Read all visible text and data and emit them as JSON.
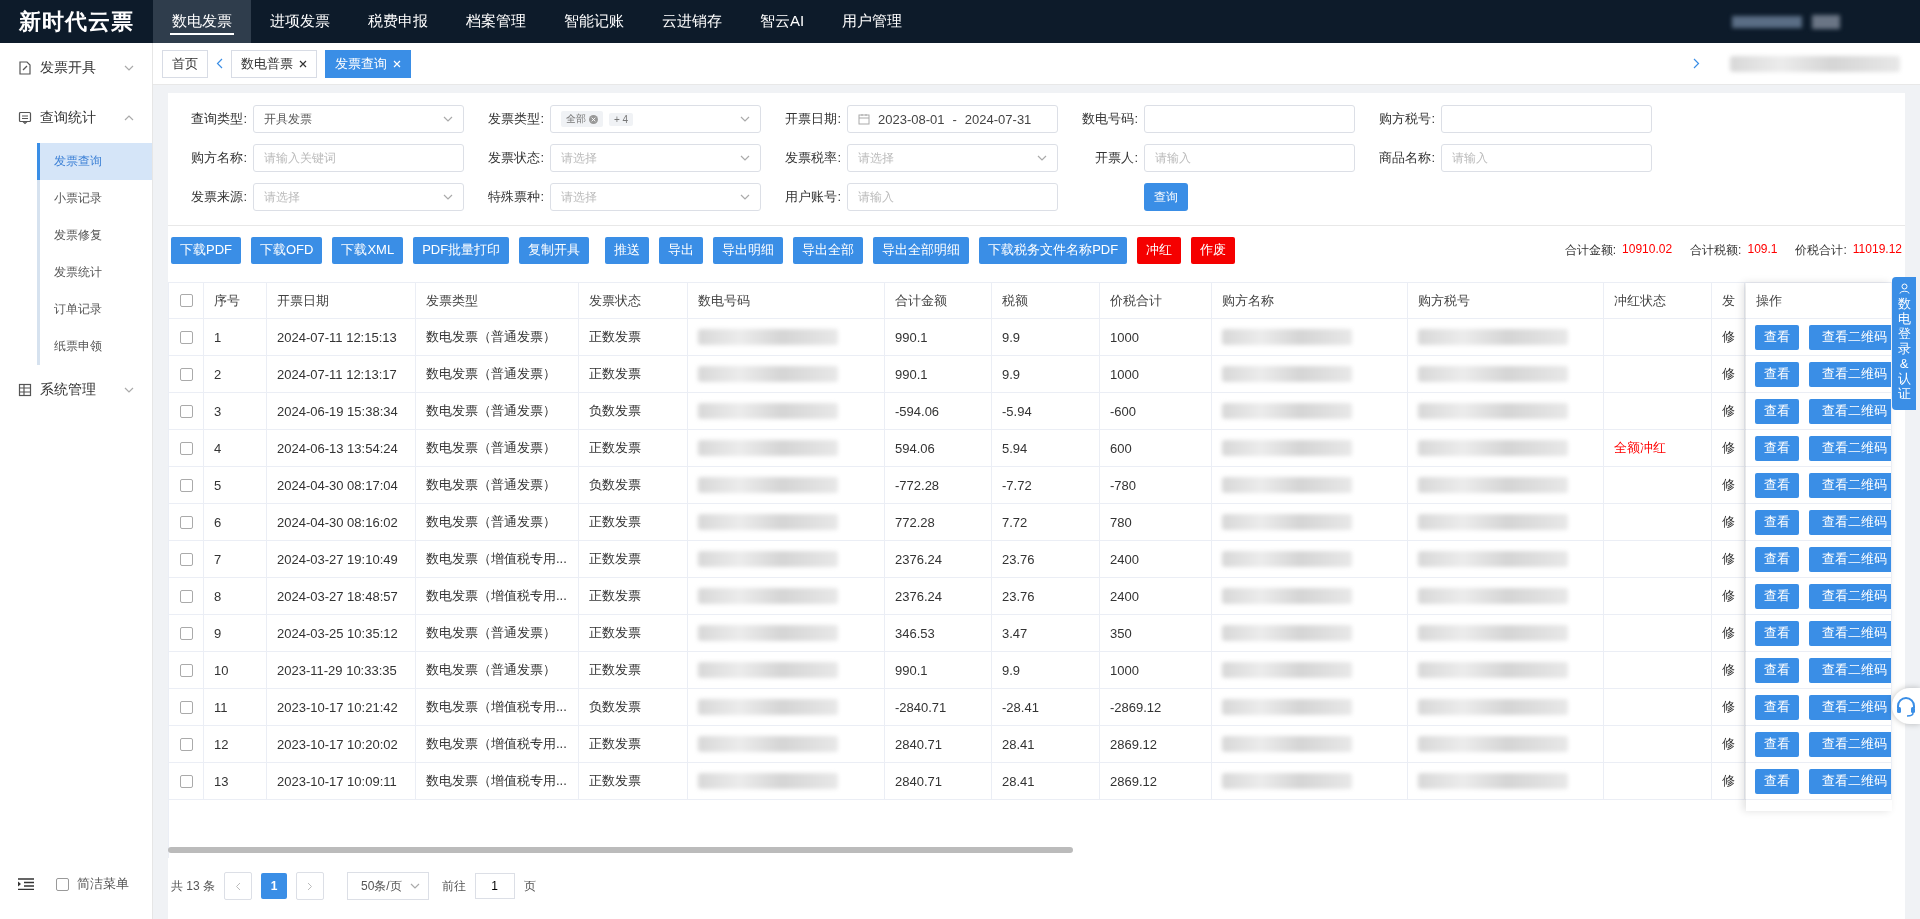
{
  "top_nav": {
    "logo": "新时代云票",
    "items": [
      {
        "label": "数电发票",
        "selected": true
      },
      {
        "label": "进项发票",
        "selected": false
      },
      {
        "label": "税费申报",
        "selected": false
      },
      {
        "label": "档案管理",
        "selected": false
      },
      {
        "label": "智能记账",
        "selected": false
      },
      {
        "label": "云进销存",
        "selected": false
      },
      {
        "label": "智云AI",
        "selected": false
      },
      {
        "label": "用户管理",
        "selected": false
      }
    ]
  },
  "sidebar": {
    "items": [
      {
        "label": "发票开具",
        "expanded": false
      },
      {
        "label": "查询统计",
        "expanded": true,
        "children": [
          {
            "label": "发票查询",
            "selected": true
          },
          {
            "label": "小票记录",
            "selected": false
          },
          {
            "label": "发票修复",
            "selected": false
          },
          {
            "label": "发票统计",
            "selected": false
          },
          {
            "label": "订单记录",
            "selected": false
          },
          {
            "label": "纸票申领",
            "selected": false
          }
        ]
      },
      {
        "label": "系统管理",
        "expanded": false
      }
    ],
    "simple_menu": {
      "label": "简洁菜单",
      "checked": false
    }
  },
  "tabs": [
    {
      "label": "首页",
      "selected": false,
      "closable": false
    },
    {
      "label": "数电普票",
      "selected": false,
      "closable": true
    },
    {
      "label": "发票查询",
      "selected": true,
      "closable": true
    }
  ],
  "filters": [
    {
      "label": "查询类型:",
      "kind": "select",
      "value": "开具发票"
    },
    {
      "label": "发票类型:",
      "kind": "tags",
      "tags": [
        "全部",
        "+ 4"
      ]
    },
    {
      "label": "开票日期:",
      "kind": "daterange",
      "start": "2023-08-01",
      "separator": "-",
      "end": "2024-07-31"
    },
    {
      "label": "数电号码:",
      "kind": "input"
    },
    {
      "label": "购方税号:",
      "kind": "input"
    },
    {
      "label": "购方名称:",
      "kind": "input",
      "placeholder": "请输入关键词"
    },
    {
      "label": "发票状态:",
      "kind": "select",
      "placeholder": "请选择"
    },
    {
      "label": "发票税率:",
      "kind": "select",
      "placeholder": "请选择"
    },
    {
      "label": "开票人:",
      "kind": "input",
      "placeholder": "请输入"
    },
    {
      "label": "商品名称:",
      "kind": "input",
      "placeholder": "请输入"
    },
    {
      "label": "发票来源:",
      "kind": "select",
      "placeholder": "请选择"
    },
    {
      "label": "特殊票种:",
      "kind": "select",
      "placeholder": "请选择"
    },
    {
      "label": "用户账号:",
      "kind": "input",
      "placeholder": "请输入"
    },
    {
      "label": "查询",
      "kind": "button"
    }
  ],
  "actions": [
    {
      "label": "下载PDF",
      "kind": "primary"
    },
    {
      "label": "下载OFD",
      "kind": "primary"
    },
    {
      "label": "下载XML",
      "kind": "primary"
    },
    {
      "label": "PDF批量打印",
      "kind": "primary"
    },
    {
      "label": "复制开具",
      "kind": "primary"
    },
    {
      "label": "推送",
      "kind": "primary"
    },
    {
      "label": "导出",
      "kind": "primary"
    },
    {
      "label": "导出明细",
      "kind": "primary"
    },
    {
      "label": "导出全部",
      "kind": "primary"
    },
    {
      "label": "导出全部明细",
      "kind": "primary"
    },
    {
      "label": "下载税务文件名称PDF",
      "kind": "primary"
    },
    {
      "label": "冲红",
      "kind": "danger"
    },
    {
      "label": "作废",
      "kind": "danger"
    }
  ],
  "totals": [
    {
      "label": "合计金额:",
      "value": "10910.02"
    },
    {
      "label": "合计税额:",
      "value": "109.1"
    },
    {
      "label": "价税合计:",
      "value": "11019.12"
    }
  ],
  "table": {
    "select_all": false,
    "columns": [
      "序号",
      "开票日期",
      "发票类型",
      "发票状态",
      "数电号码",
      "合计金额",
      "税额",
      "价税合计",
      "购方名称",
      "购方税号",
      "冲红状态",
      "发",
      "操作"
    ],
    "rows": [
      {
        "checked": false,
        "cells": [
          "1",
          "2024-07-11 12:15:13",
          "数电发票（普通发票）",
          "正数发票",
          "",
          "990.1",
          "9.9",
          "1000",
          "",
          "",
          "",
          "修"
        ],
        "ops": [
          "查看",
          "查看二维码"
        ]
      },
      {
        "checked": false,
        "cells": [
          "2",
          "2024-07-11 12:13:17",
          "数电发票（普通发票）",
          "正数发票",
          "",
          "990.1",
          "9.9",
          "1000",
          "",
          "",
          "",
          "修"
        ],
        "ops": [
          "查看",
          "查看二维码"
        ]
      },
      {
        "checked": false,
        "cells": [
          "3",
          "2024-06-19 15:38:34",
          "数电发票（普通发票）",
          "负数发票",
          "",
          "-594.06",
          "-5.94",
          "-600",
          "",
          "",
          "",
          "修"
        ],
        "ops": [
          "查看",
          "查看二维码"
        ]
      },
      {
        "checked": false,
        "cells": [
          "4",
          "2024-06-13 13:54:24",
          "数电发票（普通发票）",
          "正数发票",
          "",
          "594.06",
          "5.94",
          "600",
          "",
          "",
          "全额冲红",
          "修"
        ],
        "ops": [
          "查看",
          "查看二维码"
        ]
      },
      {
        "checked": false,
        "cells": [
          "5",
          "2024-04-30 08:17:04",
          "数电发票（普通发票）",
          "负数发票",
          "",
          "-772.28",
          "-7.72",
          "-780",
          "",
          "",
          "",
          "修"
        ],
        "ops": [
          "查看",
          "查看二维码"
        ]
      },
      {
        "checked": false,
        "cells": [
          "6",
          "2024-04-30 08:16:02",
          "数电发票（普通发票）",
          "正数发票",
          "",
          "772.28",
          "7.72",
          "780",
          "",
          "",
          "",
          "修"
        ],
        "ops": [
          "查看",
          "查看二维码"
        ]
      },
      {
        "checked": false,
        "cells": [
          "7",
          "2024-03-27 19:10:49",
          "数电发票（增值税专用...",
          "正数发票",
          "",
          "2376.24",
          "23.76",
          "2400",
          "",
          "",
          "",
          "修"
        ],
        "ops": [
          "查看",
          "查看二维码"
        ]
      },
      {
        "checked": false,
        "cells": [
          "8",
          "2024-03-27 18:48:57",
          "数电发票（增值税专用...",
          "正数发票",
          "",
          "2376.24",
          "23.76",
          "2400",
          "",
          "",
          "",
          "修"
        ],
        "ops": [
          "查看",
          "查看二维码"
        ]
      },
      {
        "checked": false,
        "cells": [
          "9",
          "2024-03-25 10:35:12",
          "数电发票（普通发票）",
          "正数发票",
          "",
          "346.53",
          "3.47",
          "350",
          "",
          "",
          "",
          "修"
        ],
        "ops": [
          "查看",
          "查看二维码"
        ]
      },
      {
        "checked": false,
        "cells": [
          "10",
          "2023-11-29 10:33:35",
          "数电发票（普通发票）",
          "正数发票",
          "",
          "990.1",
          "9.9",
          "1000",
          "",
          "",
          "",
          "修"
        ],
        "ops": [
          "查看",
          "查看二维码"
        ]
      },
      {
        "checked": false,
        "cells": [
          "11",
          "2023-10-17 10:21:42",
          "数电发票（增值税专用...",
          "负数发票",
          "",
          "-2840.71",
          "-28.41",
          "-2869.12",
          "",
          "",
          "",
          "修"
        ],
        "ops": [
          "查看",
          "查看二维码"
        ]
      },
      {
        "checked": false,
        "cells": [
          "12",
          "2023-10-17 10:20:02",
          "数电发票（增值税专用...",
          "正数发票",
          "",
          "2840.71",
          "28.41",
          "2869.12",
          "",
          "",
          "",
          "修"
        ],
        "ops": [
          "查看",
          "查看二维码"
        ]
      },
      {
        "checked": false,
        "cells": [
          "13",
          "2023-10-17 10:09:11",
          "数电发票（增值税专用...",
          "正数发票",
          "",
          "2840.71",
          "28.41",
          "2869.12",
          "",
          "",
          "",
          "修"
        ],
        "ops": [
          "查看",
          "查看二维码"
        ]
      }
    ]
  },
  "pagination": {
    "total": "共 13 条",
    "pages": [
      {
        "label": "1",
        "selected": true
      }
    ],
    "page_size": "50条/页",
    "goto_label": "前往",
    "goto_value": "1",
    "goto_unit": "页"
  },
  "side_tab": {
    "label": "数电登录&认证"
  }
}
